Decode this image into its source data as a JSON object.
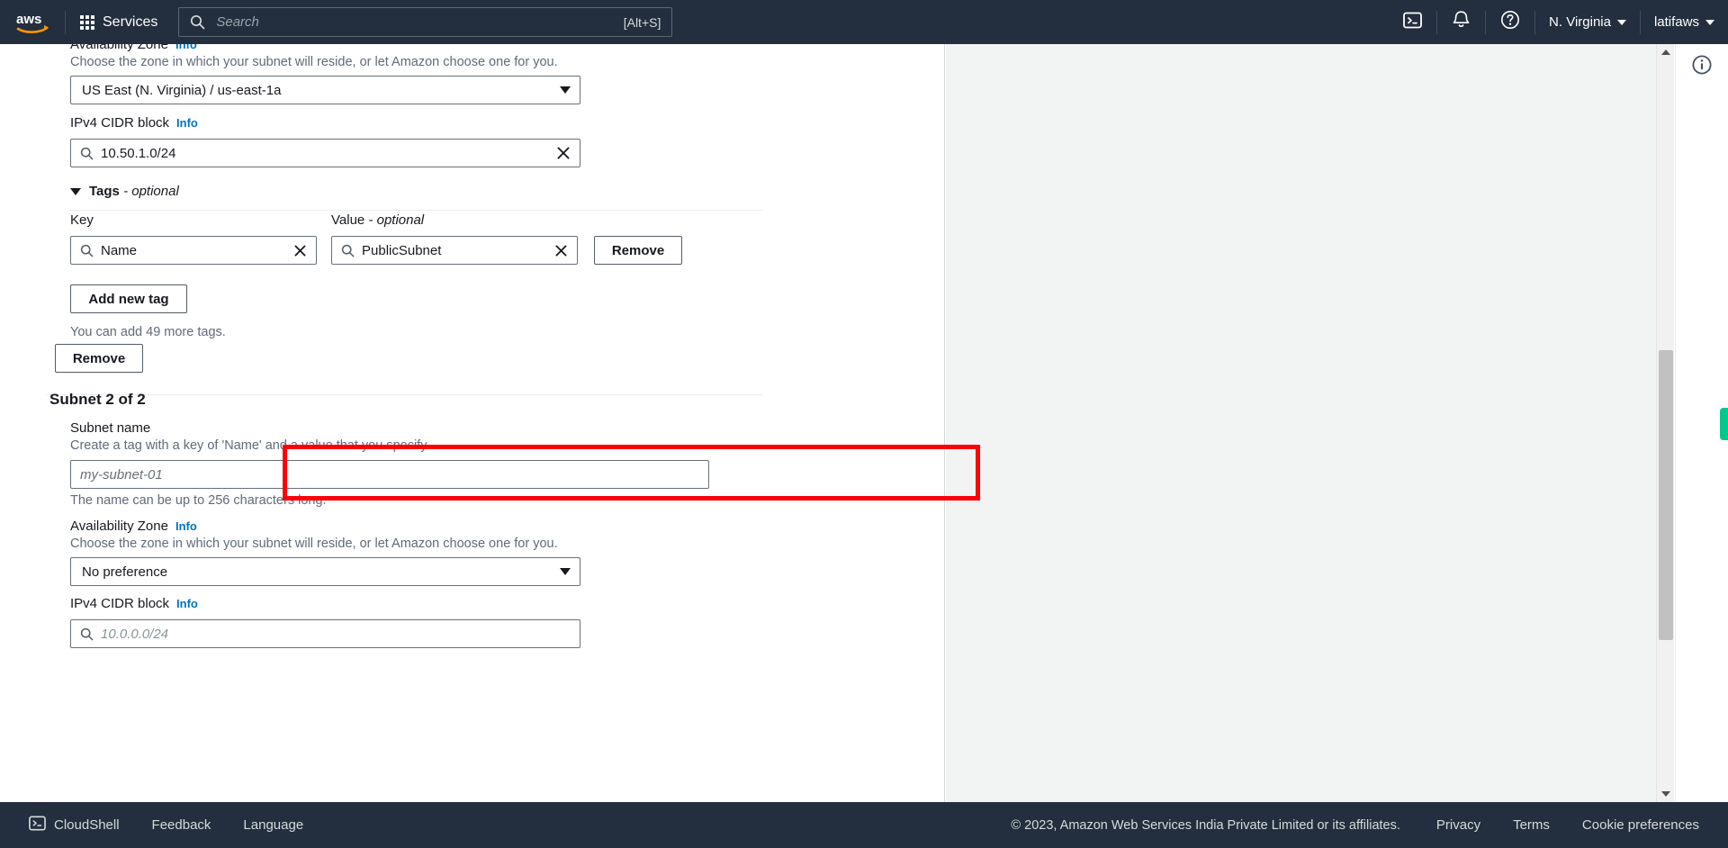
{
  "topnav": {
    "logo_alt": "aws",
    "services_label": "Services",
    "search": {
      "placeholder": "Search",
      "value": "",
      "shortcut": "[Alt+S]"
    },
    "cloudshell_icon": "cloudshell-icon",
    "notifications_icon": "bell-icon",
    "help_icon": "question-circle-icon",
    "region": "N. Virginia",
    "account": "latifaws"
  },
  "subnet1": {
    "az": {
      "label": "Availability Zone",
      "info": "Info",
      "description": "Choose the zone in which your subnet will reside, or let Amazon choose one for you.",
      "value": "US East (N. Virginia) / us-east-1a"
    },
    "cidr": {
      "label": "IPv4 CIDR block",
      "info": "Info",
      "value": "10.50.1.0/24"
    },
    "tags": {
      "section_title": "Tags",
      "section_optional": " - optional",
      "key_label": "Key",
      "value_label": "Value",
      "value_optional": " - optional",
      "key_value": "Name",
      "value_value": "PublicSubnet",
      "remove_tag_label": "Remove",
      "add_new_tag_label": "Add new tag",
      "tags_remaining": "You can add 49 more tags."
    },
    "remove_label": "Remove"
  },
  "subnet2": {
    "heading": "Subnet 2 of 2",
    "name": {
      "label": "Subnet name",
      "description": "Create a tag with a key of 'Name' and a value that you specify.",
      "placeholder": "my-subnet-01",
      "value": "",
      "hint": "The name can be up to 256 characters long."
    },
    "az": {
      "label": "Availability Zone",
      "info": "Info",
      "description": "Choose the zone in which your subnet will reside, or let Amazon choose one for you.",
      "value": "No preference"
    },
    "cidr": {
      "label": "IPv4 CIDR block",
      "info": "Info",
      "placeholder": "10.0.0.0/24",
      "value": ""
    }
  },
  "right_rail": {
    "info_icon": "info-circle-icon",
    "feedback_tab": "feedback-tab"
  },
  "footer": {
    "cloudshell": "CloudShell",
    "feedback": "Feedback",
    "language": "Language",
    "copyright": "© 2023, Amazon Web Services India Private Limited or its affiliates.",
    "privacy": "Privacy",
    "terms": "Terms",
    "cookie_preferences": "Cookie preferences"
  },
  "annotation": {
    "highlight_color": "#fb0007"
  }
}
